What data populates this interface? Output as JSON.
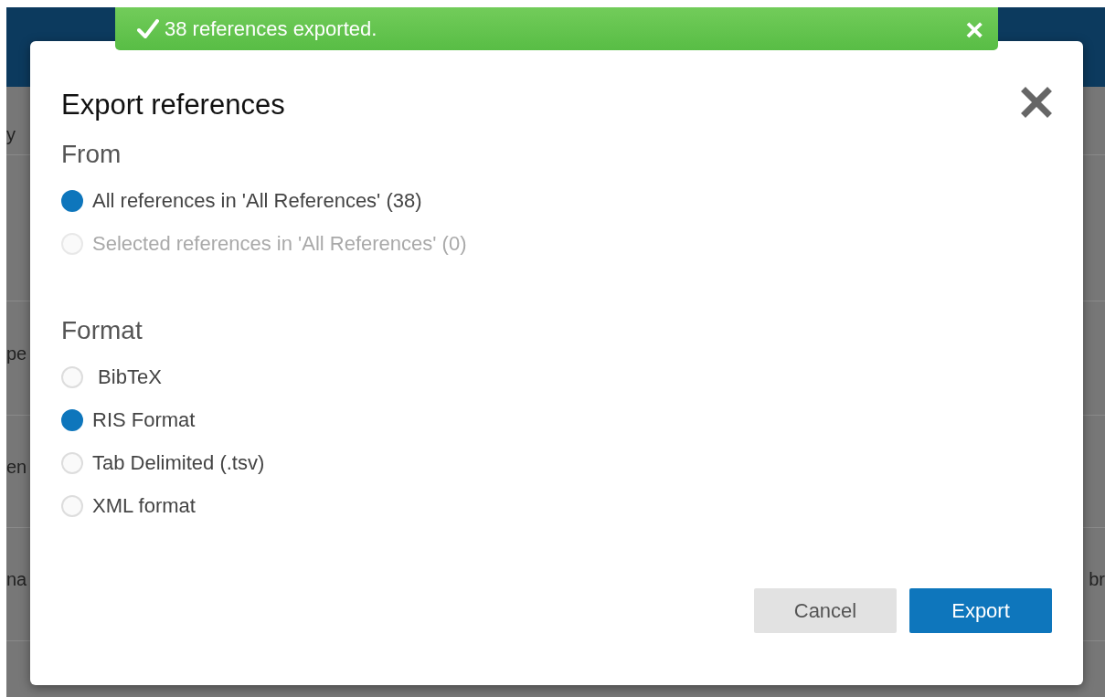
{
  "background_rows": [
    {
      "left_text": "y"
    },
    {},
    {
      "left_text": "pe"
    },
    {
      "left_text": "en"
    },
    {
      "left_text": "na",
      "right_text": "br"
    }
  ],
  "toast": {
    "message": "38 references exported.",
    "close": "×"
  },
  "dialog": {
    "title": "Export references",
    "sections": [
      {
        "heading": "From",
        "options": [
          {
            "label": "All references in 'All References' (38)",
            "selected": true,
            "disabled": false
          },
          {
            "label": "Selected references in 'All References' (0)",
            "selected": false,
            "disabled": true
          }
        ]
      },
      {
        "heading": "Format",
        "options": [
          {
            "label": " BibTeX",
            "selected": false,
            "disabled": false
          },
          {
            "label": "RIS Format",
            "selected": true,
            "disabled": false
          },
          {
            "label": "Tab Delimited (.tsv)",
            "selected": false,
            "disabled": false
          },
          {
            "label": "XML format",
            "selected": false,
            "disabled": false
          }
        ]
      }
    ],
    "buttons": [
      {
        "label": "Cancel",
        "kind": "secondary"
      },
      {
        "label": "Export",
        "kind": "primary"
      }
    ]
  }
}
